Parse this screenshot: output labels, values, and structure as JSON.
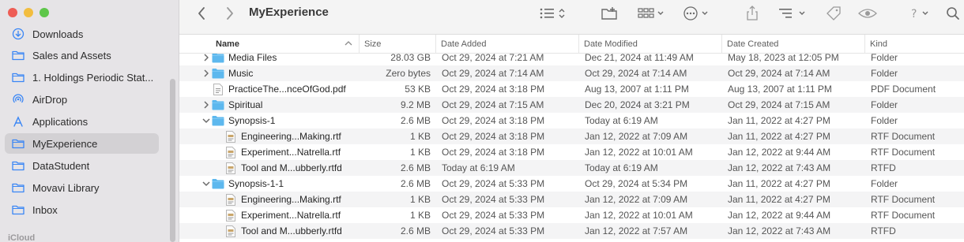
{
  "window": {
    "title": "MyExperience"
  },
  "sidebar": {
    "items": [
      {
        "label": "Downloads",
        "icon": "download-icon"
      },
      {
        "label": "Sales and Assets",
        "icon": "folder-icon"
      },
      {
        "label": "1. Holdings Periodic Stat...",
        "icon": "folder-icon"
      },
      {
        "label": "AirDrop",
        "icon": "airdrop-icon"
      },
      {
        "label": "Applications",
        "icon": "applications-icon"
      },
      {
        "label": "MyExperience",
        "icon": "folder-icon",
        "active": true
      },
      {
        "label": "DataStudent",
        "icon": "folder-icon"
      },
      {
        "label": "Movavi Library",
        "icon": "folder-icon"
      },
      {
        "label": "Inbox",
        "icon": "folder-icon"
      }
    ],
    "section_icloud": "iCloud"
  },
  "columns": {
    "name": "Name",
    "size": "Size",
    "date_added": "Date Added",
    "date_modified": "Date Modified",
    "date_created": "Date Created",
    "kind": "Kind"
  },
  "rows": [
    {
      "name": "Media Files",
      "size": "28.03 GB",
      "added": "Oct 29, 2024 at 7:21 AM",
      "modified": "Dec 21, 2024 at 11:49 AM",
      "created": "May 18, 2023 at 12:05 PM",
      "kind": "Folder",
      "type": "folder",
      "depth": 0,
      "disclosure": "collapsed"
    },
    {
      "name": "Music",
      "size": "Zero bytes",
      "added": "Oct 29, 2024 at 7:14 AM",
      "modified": "Oct 29, 2024 at 7:14 AM",
      "created": "Oct 29, 2024 at 7:14 AM",
      "kind": "Folder",
      "type": "folder",
      "depth": 0,
      "disclosure": "collapsed"
    },
    {
      "name": "PracticeThe...nceOfGod.pdf",
      "size": "53 KB",
      "added": "Oct 29, 2024 at 3:18 PM",
      "modified": "Aug 13, 2007 at 1:11 PM",
      "created": "Aug 13, 2007 at 1:11 PM",
      "kind": "PDF Document",
      "type": "pdf",
      "depth": 0,
      "disclosure": "none"
    },
    {
      "name": "Spiritual",
      "size": "9.2 MB",
      "added": "Oct 29, 2024 at 7:15 AM",
      "modified": "Dec 20, 2024 at 3:21 PM",
      "created": "Oct 29, 2024 at 7:15 AM",
      "kind": "Folder",
      "type": "folder",
      "depth": 0,
      "disclosure": "collapsed"
    },
    {
      "name": "Synopsis-1",
      "size": "2.6 MB",
      "added": "Oct 29, 2024 at 3:18 PM",
      "modified": "Today at 6:19 AM",
      "created": "Jan 11, 2022 at 4:27 PM",
      "kind": "Folder",
      "type": "folder",
      "depth": 0,
      "disclosure": "expanded"
    },
    {
      "name": "Engineering...Making.rtf",
      "size": "1 KB",
      "added": "Oct 29, 2024 at 3:18 PM",
      "modified": "Jan 12, 2022 at 7:09 AM",
      "created": "Jan 11, 2022 at 4:27 PM",
      "kind": "RTF Document",
      "type": "rtf",
      "depth": 1,
      "disclosure": "none"
    },
    {
      "name": "Experiment...Natrella.rtf",
      "size": "1 KB",
      "added": "Oct 29, 2024 at 3:18 PM",
      "modified": "Jan 12, 2022 at 10:01 AM",
      "created": "Jan 12, 2022 at 9:44 AM",
      "kind": "RTF Document",
      "type": "rtf",
      "depth": 1,
      "disclosure": "none"
    },
    {
      "name": "Tool and M...ubberly.rtfd",
      "size": "2.6 MB",
      "added": "Today at 6:19 AM",
      "modified": "Today at 6:19 AM",
      "created": "Jan 12, 2022 at 7:43 AM",
      "kind": "RTFD",
      "type": "rtf",
      "depth": 1,
      "disclosure": "none"
    },
    {
      "name": "Synopsis-1-1",
      "size": "2.6 MB",
      "added": "Oct 29, 2024 at 5:33 PM",
      "modified": "Oct 29, 2024 at 5:34 PM",
      "created": "Jan 11, 2022 at 4:27 PM",
      "kind": "Folder",
      "type": "folder",
      "depth": 0,
      "disclosure": "expanded"
    },
    {
      "name": "Engineering...Making.rtf",
      "size": "1 KB",
      "added": "Oct 29, 2024 at 5:33 PM",
      "modified": "Jan 12, 2022 at 7:09 AM",
      "created": "Jan 11, 2022 at 4:27 PM",
      "kind": "RTF Document",
      "type": "rtf",
      "depth": 1,
      "disclosure": "none"
    },
    {
      "name": "Experiment...Natrella.rtf",
      "size": "1 KB",
      "added": "Oct 29, 2024 at 5:33 PM",
      "modified": "Jan 12, 2022 at 10:01 AM",
      "created": "Jan 12, 2022 at 9:44 AM",
      "kind": "RTF Document",
      "type": "rtf",
      "depth": 1,
      "disclosure": "none"
    },
    {
      "name": "Tool and M...ubberly.rtfd",
      "size": "2.6 MB",
      "added": "Oct 29, 2024 at 5:33 PM",
      "modified": "Jan 12, 2022 at 7:57 AM",
      "created": "Jan 12, 2022 at 7:43 AM",
      "kind": "RTFD",
      "type": "rtf",
      "depth": 1,
      "disclosure": "none"
    }
  ],
  "colors": {
    "folder": "#5db8ee",
    "accent": "#3a86f5",
    "sidebar_bg": "#e6e4e7"
  }
}
